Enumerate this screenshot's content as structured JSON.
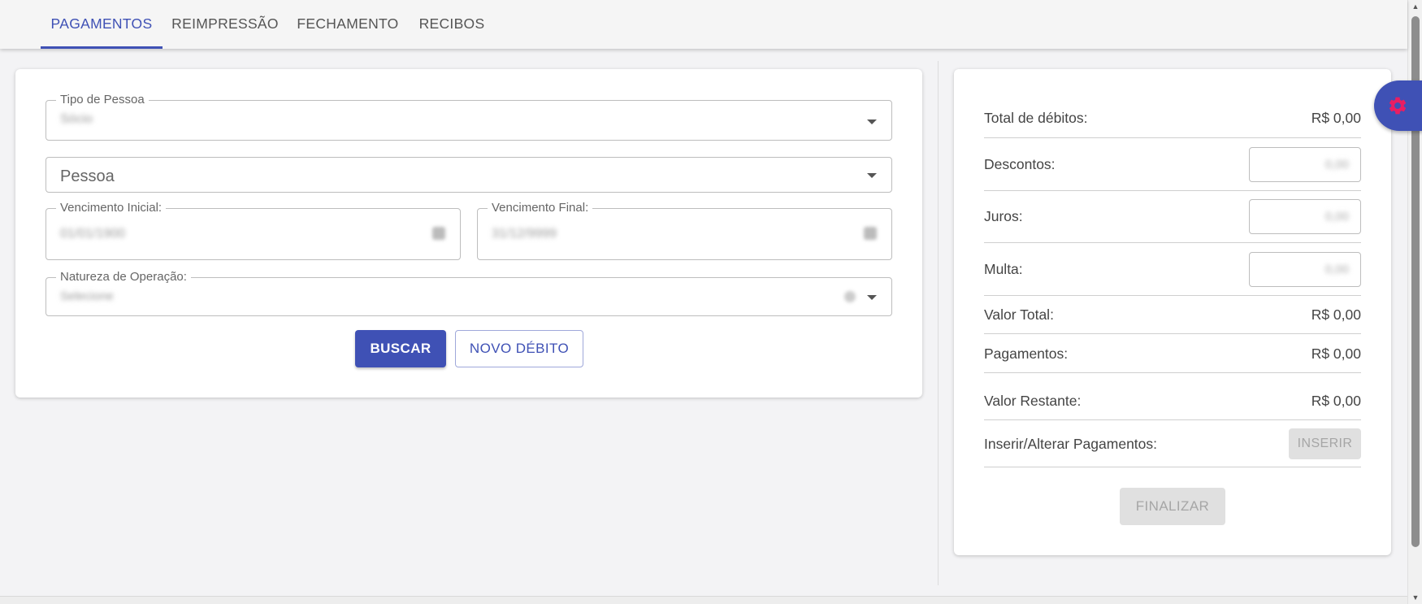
{
  "tabs": [
    {
      "label": "PAGAMENTOS",
      "active": true
    },
    {
      "label": "REIMPRESSÃO",
      "active": false
    },
    {
      "label": "FECHAMENTO",
      "active": false
    },
    {
      "label": "RECIBOS",
      "active": false
    }
  ],
  "filters": {
    "tipo_pessoa": {
      "label": "Tipo de Pessoa",
      "value": "Sócio"
    },
    "pessoa": {
      "placeholder": "Pessoa"
    },
    "vencimento_inicial": {
      "label": "Vencimento Inicial:",
      "value": "01/01/1900"
    },
    "vencimento_final": {
      "label": "Vencimento Final:",
      "value": "31/12/9999"
    },
    "natureza_operacao": {
      "label": "Natureza de Operação:",
      "value": "Selecione"
    },
    "buscar_label": "BUSCAR",
    "novo_debito_label": "NOVO DÉBITO"
  },
  "summary": {
    "total_debitos": {
      "label": "Total de débitos:",
      "value": "R$ 0,00"
    },
    "descontos": {
      "label": "Descontos:",
      "value": "0,00"
    },
    "juros": {
      "label": "Juros:",
      "value": "0,00"
    },
    "multa": {
      "label": "Multa:",
      "value": "0,00"
    },
    "valor_total": {
      "label": "Valor Total:",
      "value": "R$ 0,00"
    },
    "pagamentos": {
      "label": "Pagamentos:",
      "value": "R$ 0,00"
    },
    "valor_restante": {
      "label": "Valor Restante:",
      "value": "R$ 0,00"
    },
    "inserir_alterar": {
      "label": "Inserir/Alterar Pagamentos:",
      "button_label": "INSERIR"
    },
    "finalizar_label": "FINALIZAR"
  },
  "colors": {
    "primary": "#3f51b5",
    "settings_icon": "#e91e63"
  },
  "icons": {
    "settings": "gear-icon",
    "dropdown": "chevron-down-icon",
    "calendar": "calendar-icon"
  }
}
